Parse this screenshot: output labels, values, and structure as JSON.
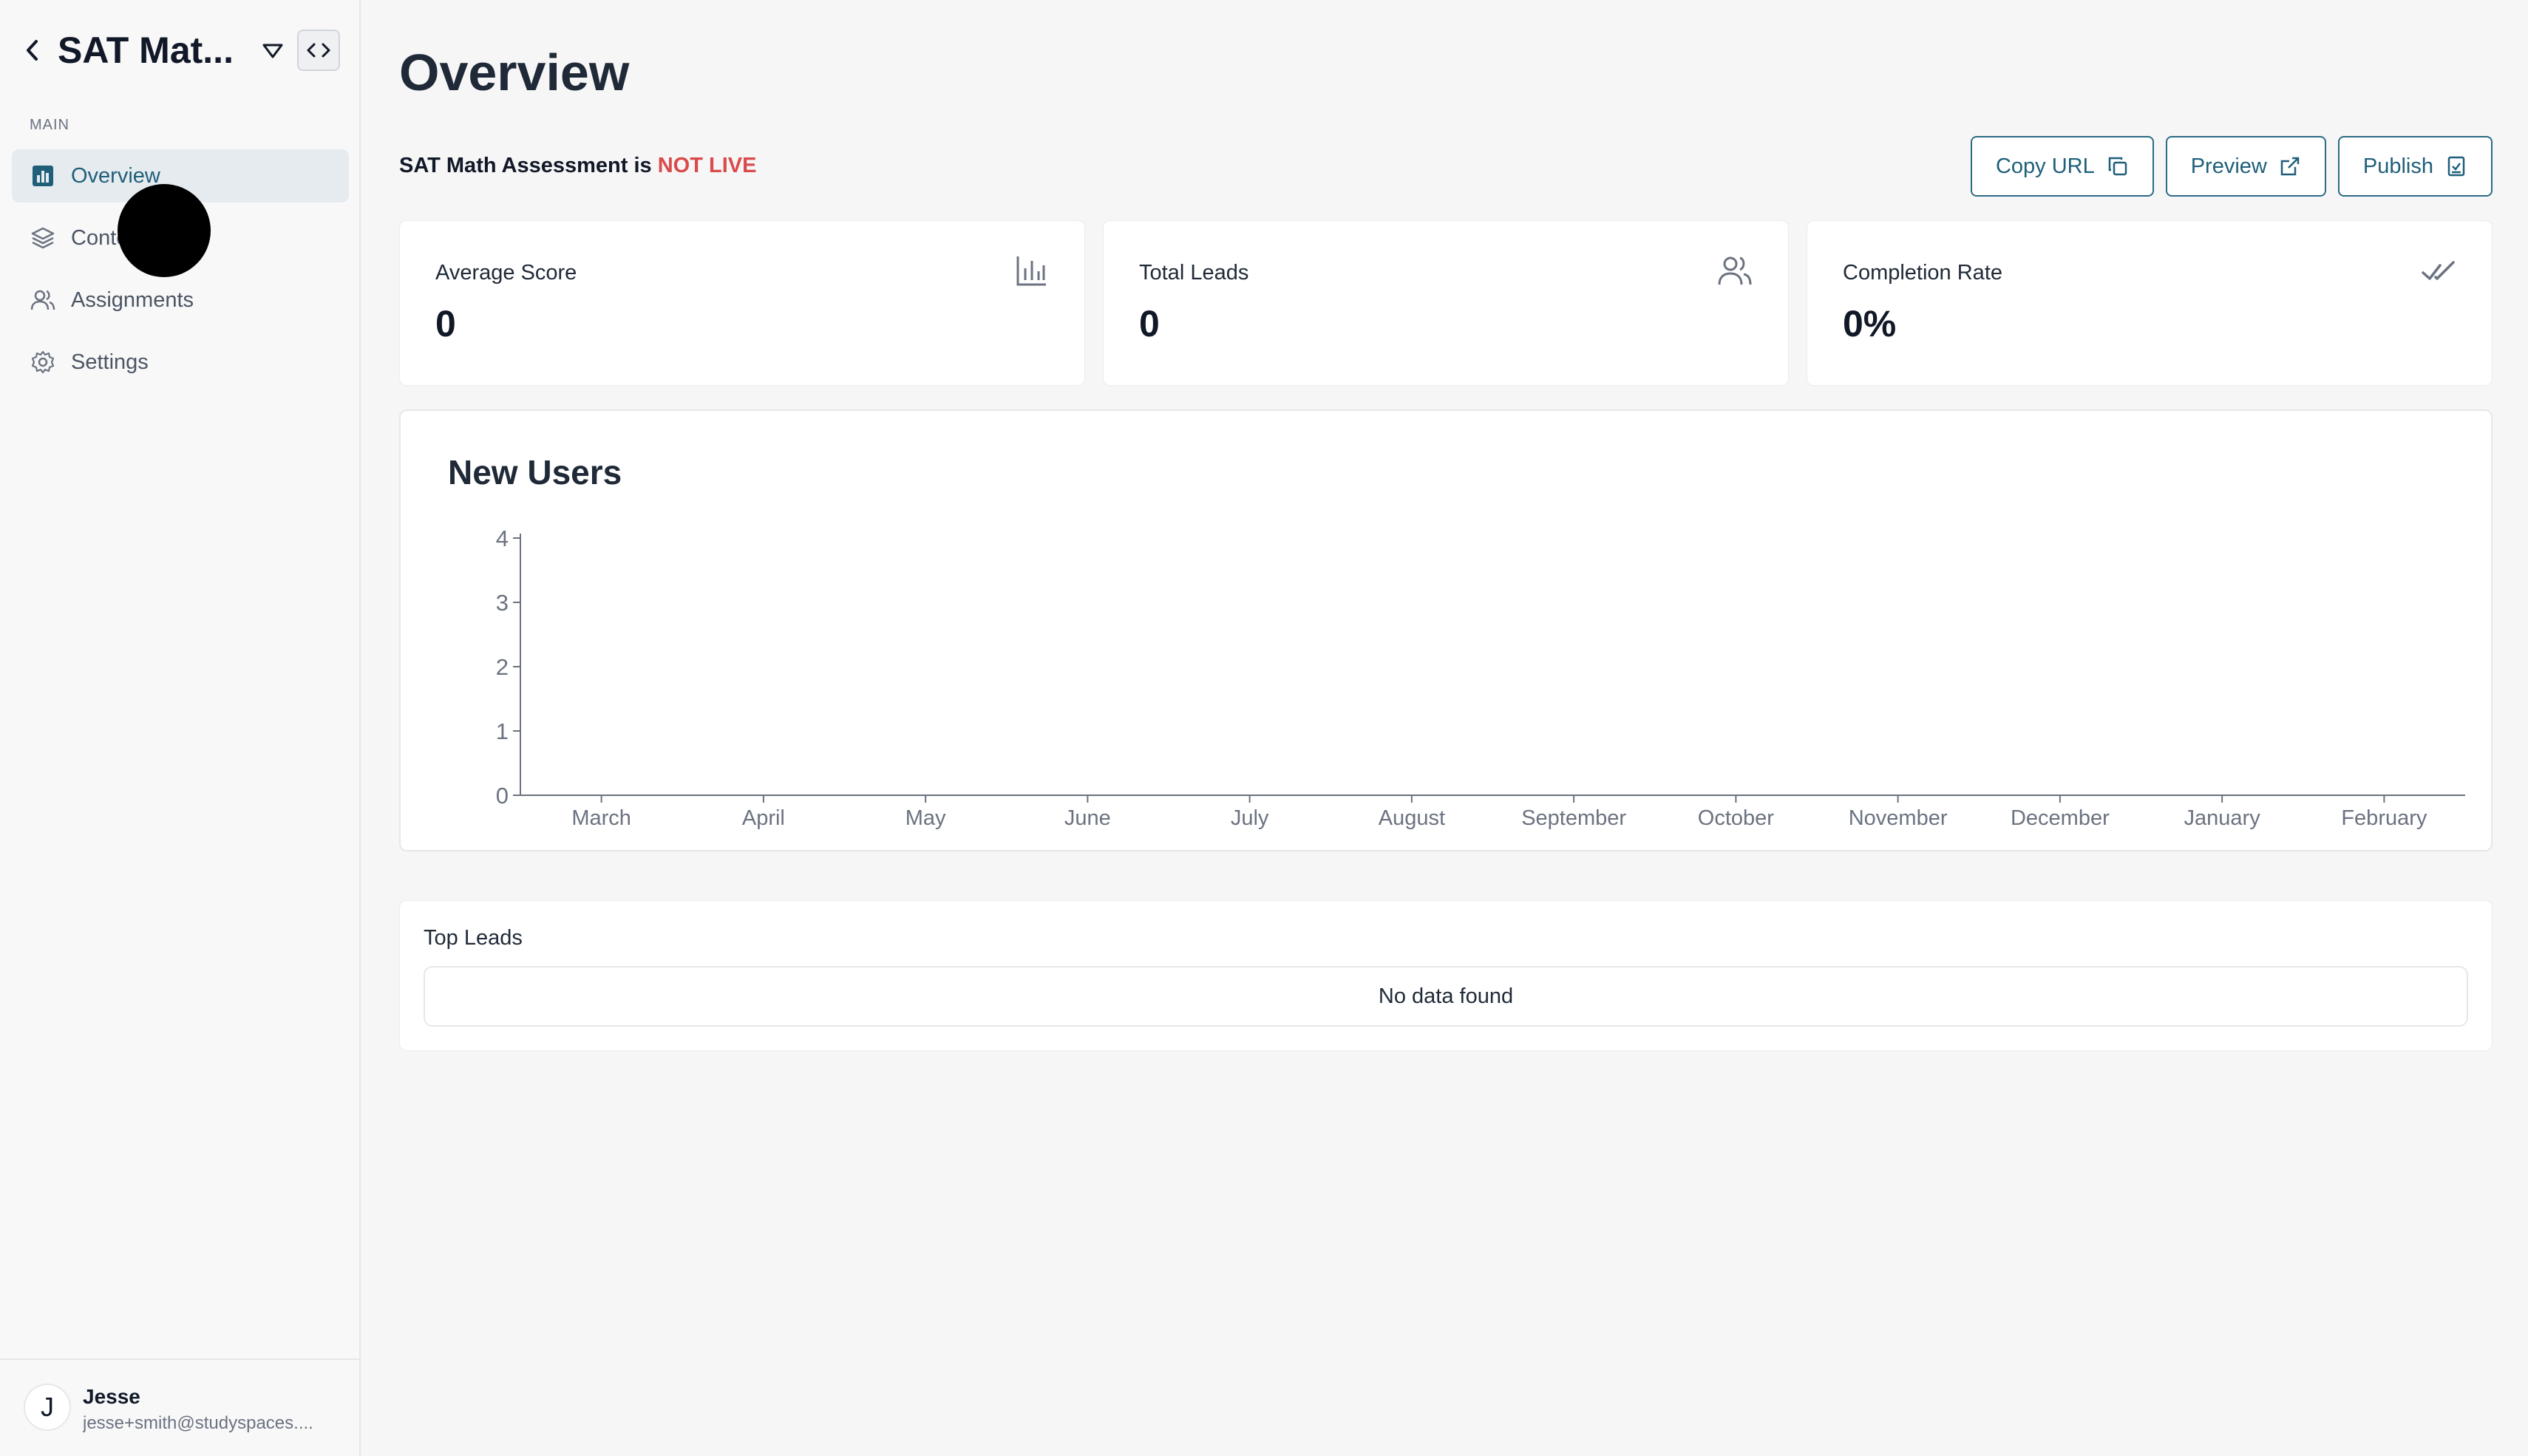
{
  "sidebar": {
    "title": "SAT Mat...",
    "section_label": "MAIN",
    "items": [
      {
        "label": "Overview",
        "icon": "chart-square-icon",
        "active": true
      },
      {
        "label": "Content",
        "icon": "layers-icon",
        "active": false
      },
      {
        "label": "Assignments",
        "icon": "users-icon",
        "active": false
      },
      {
        "label": "Settings",
        "icon": "gear-icon",
        "active": false
      }
    ],
    "user": {
      "initial": "J",
      "name": "Jesse",
      "email": "jesse+smith@studyspaces...."
    }
  },
  "main": {
    "title": "Overview",
    "status": {
      "prefix": "SAT Math Assessment is ",
      "state": "NOT LIVE"
    },
    "actions": [
      {
        "label": "Copy URL",
        "icon": "copy-icon"
      },
      {
        "label": "Preview",
        "icon": "external-link-icon"
      },
      {
        "label": "Publish",
        "icon": "publish-icon"
      }
    ],
    "stats": [
      {
        "label": "Average Score",
        "value": "0",
        "icon": "bar-chart-icon"
      },
      {
        "label": "Total Leads",
        "value": "0",
        "icon": "users-icon"
      },
      {
        "label": "Completion Rate",
        "value": "0%",
        "icon": "double-check-icon"
      }
    ],
    "top_leads": {
      "title": "Top Leads",
      "empty_text": "No data found"
    }
  },
  "colors": {
    "accent": "#1f5f7a",
    "danger": "#d94b4b",
    "active_bg": "#e6ebef"
  },
  "chart_data": {
    "type": "line",
    "title": "New Users",
    "categories": [
      "March",
      "April",
      "May",
      "June",
      "July",
      "August",
      "September",
      "October",
      "November",
      "December",
      "January",
      "February"
    ],
    "series": [
      {
        "values": [
          0,
          0,
          0,
          0,
          0,
          0,
          0,
          0,
          0,
          0,
          0,
          0
        ]
      }
    ],
    "yticks": [
      "0",
      "1",
      "2",
      "3",
      "4"
    ],
    "ylim": [
      0,
      4
    ],
    "grid": false,
    "xlabel": "",
    "ylabel": ""
  }
}
